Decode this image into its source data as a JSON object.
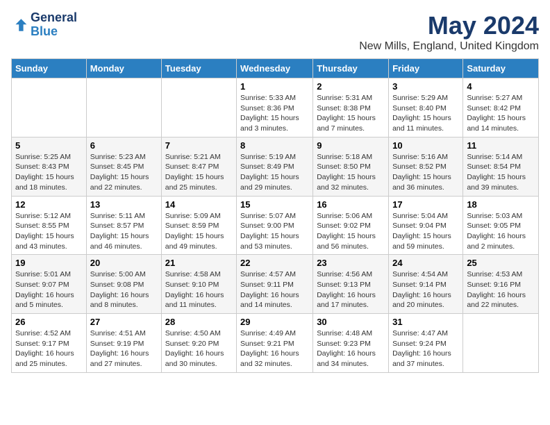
{
  "header": {
    "logo_line1": "General",
    "logo_line2": "Blue",
    "month_title": "May 2024",
    "location": "New Mills, England, United Kingdom"
  },
  "days_of_week": [
    "Sunday",
    "Monday",
    "Tuesday",
    "Wednesday",
    "Thursday",
    "Friday",
    "Saturday"
  ],
  "weeks": [
    [
      {
        "day": "",
        "info": ""
      },
      {
        "day": "",
        "info": ""
      },
      {
        "day": "",
        "info": ""
      },
      {
        "day": "1",
        "info": "Sunrise: 5:33 AM\nSunset: 8:36 PM\nDaylight: 15 hours\nand 3 minutes."
      },
      {
        "day": "2",
        "info": "Sunrise: 5:31 AM\nSunset: 8:38 PM\nDaylight: 15 hours\nand 7 minutes."
      },
      {
        "day": "3",
        "info": "Sunrise: 5:29 AM\nSunset: 8:40 PM\nDaylight: 15 hours\nand 11 minutes."
      },
      {
        "day": "4",
        "info": "Sunrise: 5:27 AM\nSunset: 8:42 PM\nDaylight: 15 hours\nand 14 minutes."
      }
    ],
    [
      {
        "day": "5",
        "info": "Sunrise: 5:25 AM\nSunset: 8:43 PM\nDaylight: 15 hours\nand 18 minutes."
      },
      {
        "day": "6",
        "info": "Sunrise: 5:23 AM\nSunset: 8:45 PM\nDaylight: 15 hours\nand 22 minutes."
      },
      {
        "day": "7",
        "info": "Sunrise: 5:21 AM\nSunset: 8:47 PM\nDaylight: 15 hours\nand 25 minutes."
      },
      {
        "day": "8",
        "info": "Sunrise: 5:19 AM\nSunset: 8:49 PM\nDaylight: 15 hours\nand 29 minutes."
      },
      {
        "day": "9",
        "info": "Sunrise: 5:18 AM\nSunset: 8:50 PM\nDaylight: 15 hours\nand 32 minutes."
      },
      {
        "day": "10",
        "info": "Sunrise: 5:16 AM\nSunset: 8:52 PM\nDaylight: 15 hours\nand 36 minutes."
      },
      {
        "day": "11",
        "info": "Sunrise: 5:14 AM\nSunset: 8:54 PM\nDaylight: 15 hours\nand 39 minutes."
      }
    ],
    [
      {
        "day": "12",
        "info": "Sunrise: 5:12 AM\nSunset: 8:55 PM\nDaylight: 15 hours\nand 43 minutes."
      },
      {
        "day": "13",
        "info": "Sunrise: 5:11 AM\nSunset: 8:57 PM\nDaylight: 15 hours\nand 46 minutes."
      },
      {
        "day": "14",
        "info": "Sunrise: 5:09 AM\nSunset: 8:59 PM\nDaylight: 15 hours\nand 49 minutes."
      },
      {
        "day": "15",
        "info": "Sunrise: 5:07 AM\nSunset: 9:00 PM\nDaylight: 15 hours\nand 53 minutes."
      },
      {
        "day": "16",
        "info": "Sunrise: 5:06 AM\nSunset: 9:02 PM\nDaylight: 15 hours\nand 56 minutes."
      },
      {
        "day": "17",
        "info": "Sunrise: 5:04 AM\nSunset: 9:04 PM\nDaylight: 15 hours\nand 59 minutes."
      },
      {
        "day": "18",
        "info": "Sunrise: 5:03 AM\nSunset: 9:05 PM\nDaylight: 16 hours\nand 2 minutes."
      }
    ],
    [
      {
        "day": "19",
        "info": "Sunrise: 5:01 AM\nSunset: 9:07 PM\nDaylight: 16 hours\nand 5 minutes."
      },
      {
        "day": "20",
        "info": "Sunrise: 5:00 AM\nSunset: 9:08 PM\nDaylight: 16 hours\nand 8 minutes."
      },
      {
        "day": "21",
        "info": "Sunrise: 4:58 AM\nSunset: 9:10 PM\nDaylight: 16 hours\nand 11 minutes."
      },
      {
        "day": "22",
        "info": "Sunrise: 4:57 AM\nSunset: 9:11 PM\nDaylight: 16 hours\nand 14 minutes."
      },
      {
        "day": "23",
        "info": "Sunrise: 4:56 AM\nSunset: 9:13 PM\nDaylight: 16 hours\nand 17 minutes."
      },
      {
        "day": "24",
        "info": "Sunrise: 4:54 AM\nSunset: 9:14 PM\nDaylight: 16 hours\nand 20 minutes."
      },
      {
        "day": "25",
        "info": "Sunrise: 4:53 AM\nSunset: 9:16 PM\nDaylight: 16 hours\nand 22 minutes."
      }
    ],
    [
      {
        "day": "26",
        "info": "Sunrise: 4:52 AM\nSunset: 9:17 PM\nDaylight: 16 hours\nand 25 minutes."
      },
      {
        "day": "27",
        "info": "Sunrise: 4:51 AM\nSunset: 9:19 PM\nDaylight: 16 hours\nand 27 minutes."
      },
      {
        "day": "28",
        "info": "Sunrise: 4:50 AM\nSunset: 9:20 PM\nDaylight: 16 hours\nand 30 minutes."
      },
      {
        "day": "29",
        "info": "Sunrise: 4:49 AM\nSunset: 9:21 PM\nDaylight: 16 hours\nand 32 minutes."
      },
      {
        "day": "30",
        "info": "Sunrise: 4:48 AM\nSunset: 9:23 PM\nDaylight: 16 hours\nand 34 minutes."
      },
      {
        "day": "31",
        "info": "Sunrise: 4:47 AM\nSunset: 9:24 PM\nDaylight: 16 hours\nand 37 minutes."
      },
      {
        "day": "",
        "info": ""
      }
    ]
  ]
}
